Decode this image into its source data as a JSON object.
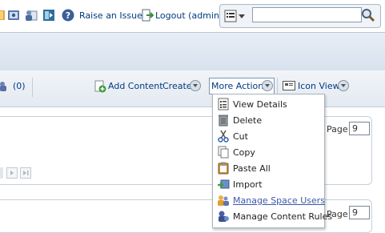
{
  "toolbar": {
    "raise_issue": "Raise an Issue",
    "logout": "Logout (admin)",
    "search_value": ""
  },
  "actions": {
    "count": "(0)",
    "add_content": "Add Content",
    "create": "Create",
    "more_actions": "More Actions",
    "icon_view": "Icon View"
  },
  "panels": [
    {
      "page_label": "Page",
      "page_value": "9"
    },
    {
      "page_label": "Page",
      "page_value": "9"
    }
  ],
  "more_actions_menu": {
    "items": [
      {
        "label": "View Details",
        "icon": "details-icon"
      },
      {
        "label": "Delete",
        "icon": "trash-icon"
      },
      {
        "label": "Cut",
        "icon": "scissors-icon"
      },
      {
        "label": "Copy",
        "icon": "copy-icon"
      },
      {
        "label": "Paste All",
        "icon": "clipboard-icon"
      },
      {
        "label": "Import",
        "icon": "import-icon"
      },
      {
        "label": "Manage Space Users",
        "icon": "users-icon"
      },
      {
        "label": "Manage Content Rules",
        "icon": "rules-icon"
      }
    ],
    "hovered_item": "Manage Space Users"
  },
  "colors": {
    "link": "#003a80",
    "menu_hover": "#3d58a8",
    "band": "#dfe7f1"
  }
}
